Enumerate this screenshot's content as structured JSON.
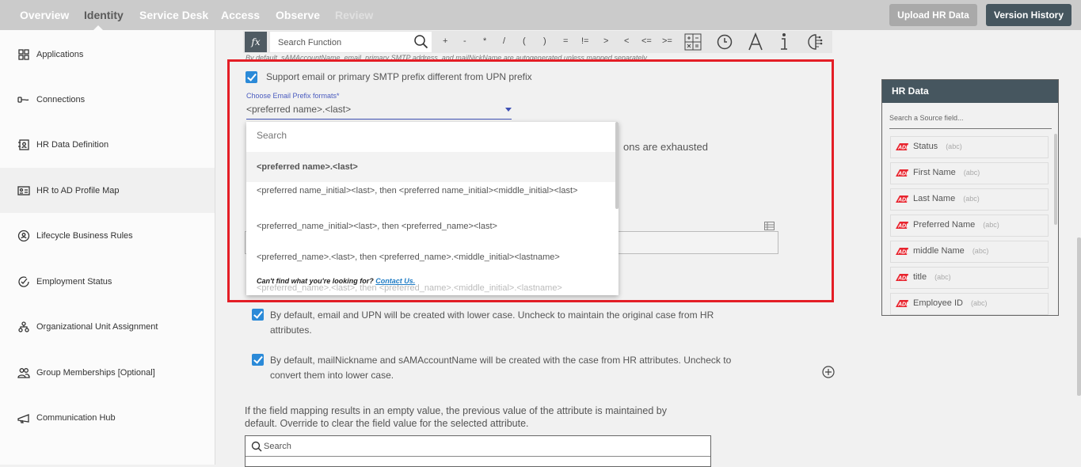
{
  "nav": {
    "tabs": [
      "Overview",
      "Identity",
      "Service Desk",
      "Access",
      "Observe",
      "Review"
    ],
    "active": "Identity",
    "upload_button": "Upload HR Data",
    "version_button": "Version History"
  },
  "sidebar": {
    "items": [
      "Applications",
      "Connections",
      "HR Data Definition",
      "HR to AD Profile Map",
      "Lifecycle Business Rules",
      "Employment Status",
      "Organizational Unit Assignment",
      "Group Memberships [Optional]",
      "Communication Hub"
    ],
    "active": "HR to AD Profile Map"
  },
  "toolbar": {
    "fx": "fx",
    "search_placeholder": "Search Function",
    "operators": [
      "+",
      "-",
      "*",
      "/",
      "(",
      ")",
      "=",
      "!=",
      ">",
      "<",
      "<=",
      ">="
    ]
  },
  "note": "By default, sAMAccountName, email, primary SMTP address, and mailNickName are autogenerated unless mapped separately.",
  "email_prefix": {
    "checkbox_label": "Support email or primary SMTP prefix different from UPN prefix",
    "checked": true,
    "field_label": "Choose Email Prefix formats*",
    "selected": "<preferred name>.<last>",
    "behind_text": "ons are exhausted"
  },
  "dropdown": {
    "search_placeholder": "Search",
    "options": [
      "<preferred name>.<last>",
      "<preferred name_initial><last>, then <preferred name_initial><middle_initial><last>",
      "<preferred_name_initial><last>, then <preferred_name><last>",
      "<preferred_name>.<last>, then <preferred_name>.<middle_initial><lastname>",
      "<preferred_name>.<last>, then <preferred_name>.<middle_initial>.<lastname>"
    ],
    "footer_text": "Can't find what you're looking for?",
    "footer_link": "Contact Us."
  },
  "options": [
    {
      "label": "By default, email and UPN will be created with lower case. Uncheck to maintain the original case from HR attributes.",
      "checked": true
    },
    {
      "label": "By default, mailNickname and sAMAccountName will be created with the case from HR attributes. Uncheck to convert them into lower case.",
      "checked": true
    }
  ],
  "empty_value_text": "If the field mapping results in an empty value, the previous value of the attribute is maintained by default. Override to clear the field value for the selected attribute.",
  "attr_search_placeholder": "Search",
  "hr_data": {
    "title": "HR Data",
    "search_placeholder": "Search a Source field...",
    "fields": [
      {
        "name": "Status",
        "type": "(abc)"
      },
      {
        "name": "First Name",
        "type": "(abc)"
      },
      {
        "name": "Last Name",
        "type": "(abc)"
      },
      {
        "name": "Preferred Name",
        "type": "(abc)"
      },
      {
        "name": "middle Name",
        "type": "(abc)"
      },
      {
        "name": "title",
        "type": "(abc)"
      },
      {
        "name": "Employee ID",
        "type": "(abc)"
      }
    ]
  },
  "colors": {
    "accent": "#2b8ad8",
    "highlight_border": "#e41e26",
    "header_dark": "#46565f"
  }
}
